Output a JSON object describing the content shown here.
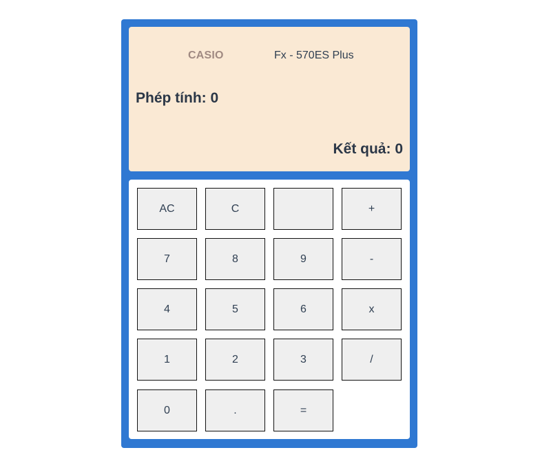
{
  "display": {
    "brand": "CASIO",
    "model": "Fx - 570ES Plus",
    "expression": "Phép tính: 0",
    "result": "Kết quả: 0"
  },
  "keys": {
    "ac": "AC",
    "clear": "C",
    "blank": "",
    "plus": "+",
    "seven": "7",
    "eight": "8",
    "nine": "9",
    "minus": "-",
    "four": "4",
    "five": "5",
    "six": "6",
    "multiply": "x",
    "one": "1",
    "two": "2",
    "three": "3",
    "divide": "/",
    "zero": "0",
    "dot": ".",
    "equals": "="
  },
  "colors": {
    "frame": "#2f78d2",
    "display_bg": "#fae9d4",
    "key_bg": "#efefef",
    "brand_text": "#a08a82",
    "text": "#2b3747"
  }
}
